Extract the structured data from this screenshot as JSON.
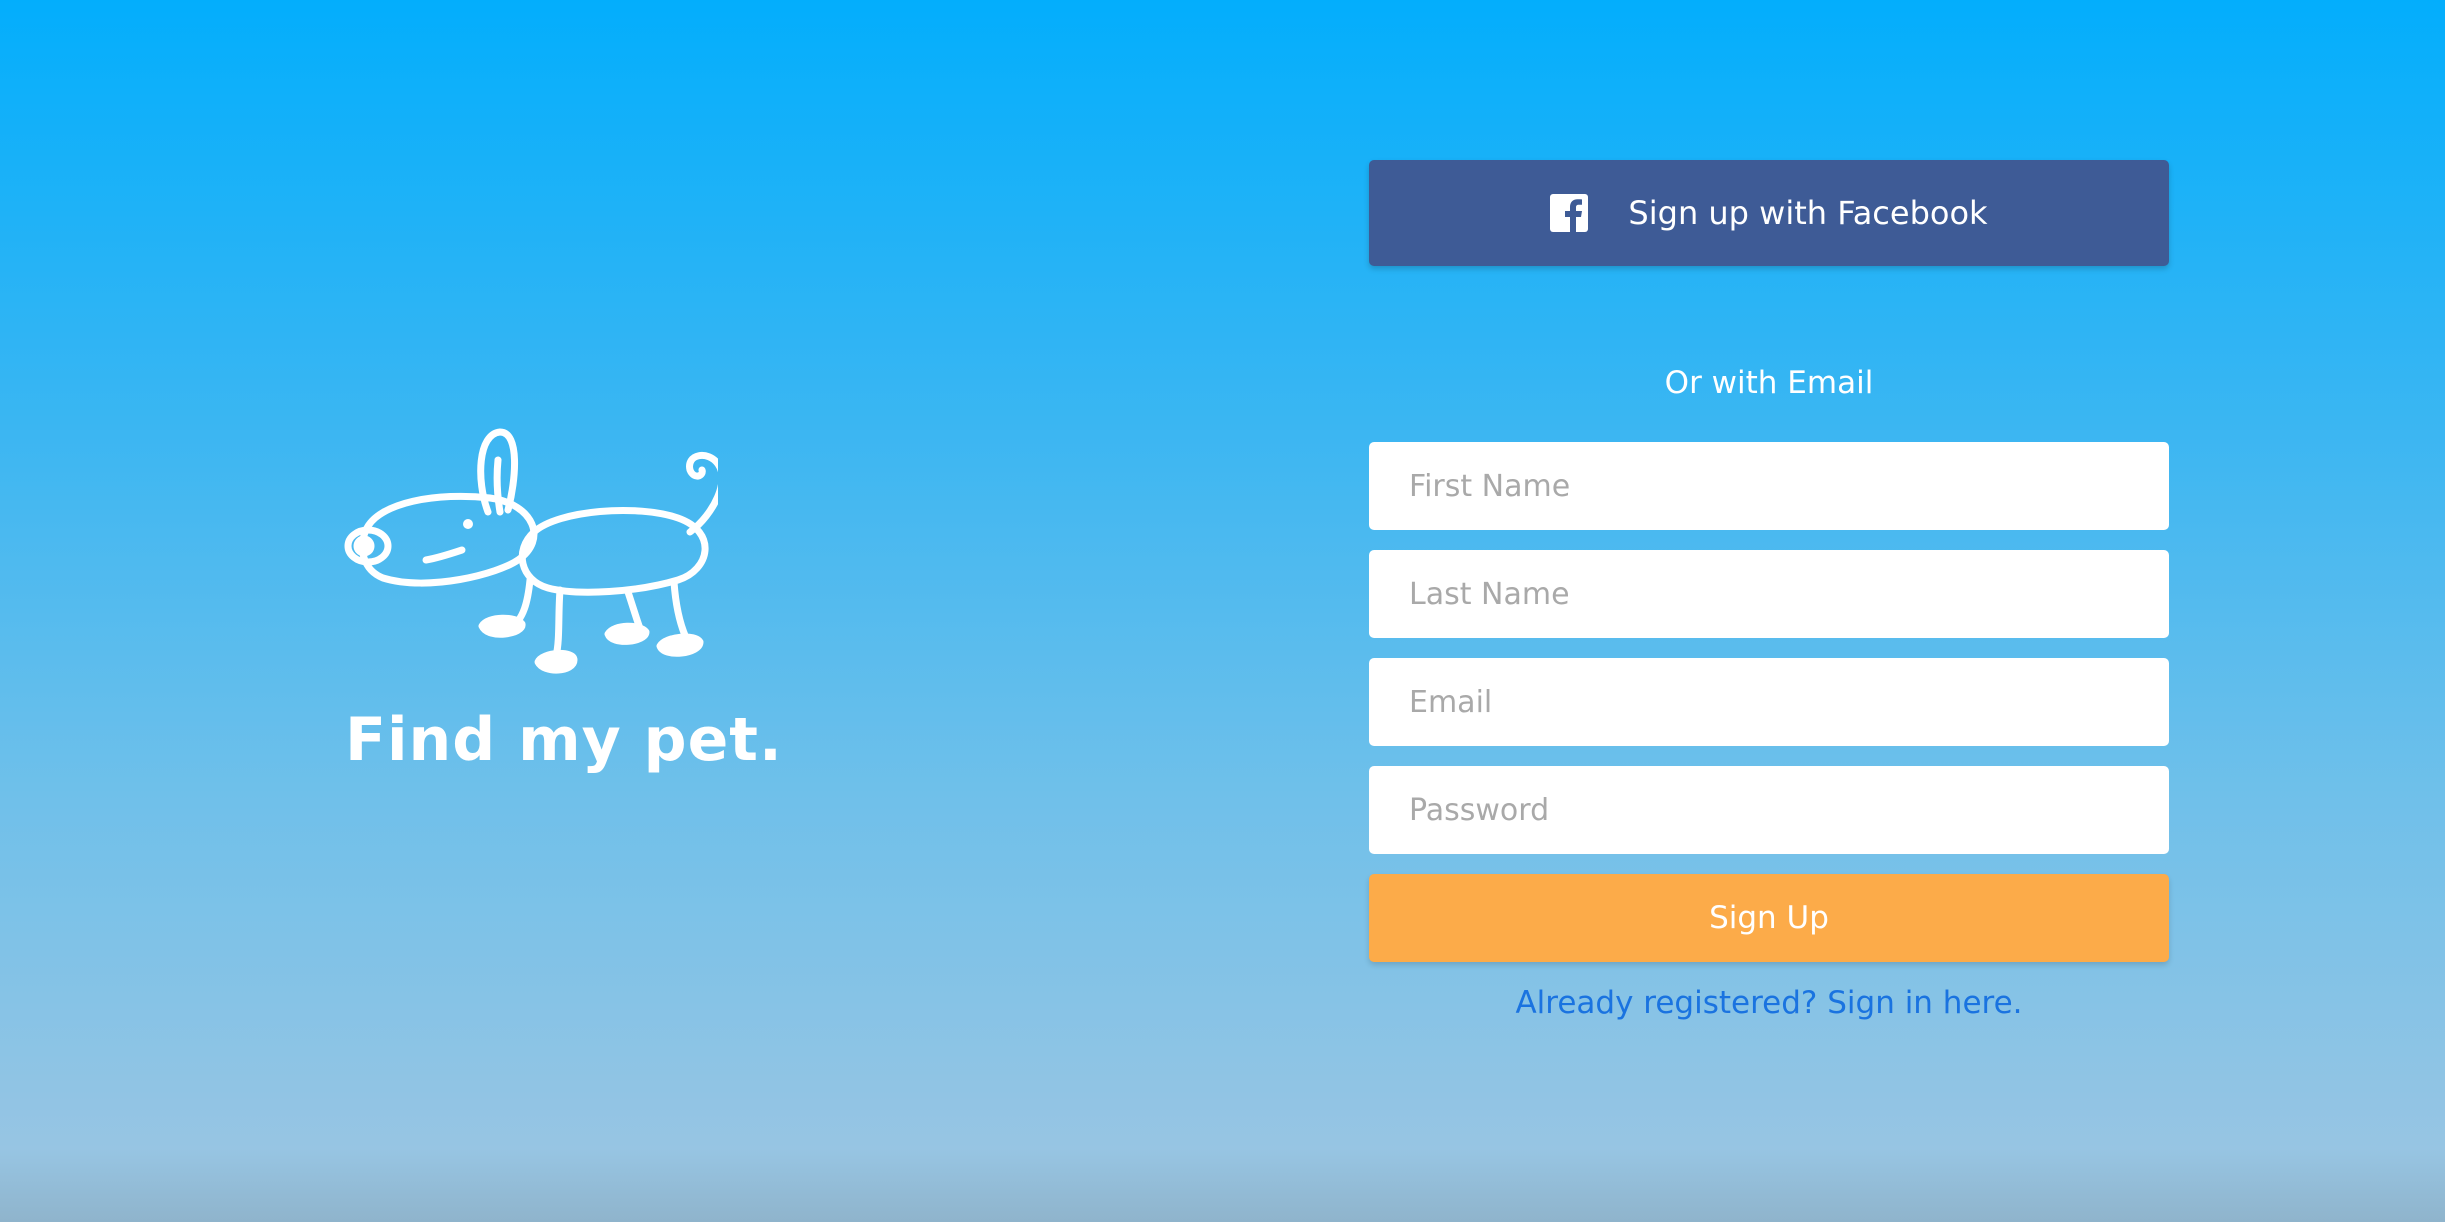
{
  "brand": {
    "title": "Find my pet.",
    "logo_icon": "dog-icon"
  },
  "facebook_button": {
    "label": "Sign up with Facebook",
    "icon": "facebook-icon",
    "color": "#3e5b96"
  },
  "divider_text": "Or with Email",
  "fields": {
    "first_name": {
      "placeholder": "First Name",
      "value": ""
    },
    "last_name": {
      "placeholder": "Last Name",
      "value": ""
    },
    "email": {
      "placeholder": "Email",
      "value": ""
    },
    "password": {
      "placeholder": "Password",
      "value": ""
    }
  },
  "signup_button": {
    "label": "Sign Up",
    "color": "#fcab49"
  },
  "signin_link": {
    "label": "Already registered? Sign in here.",
    "color": "#1a73e0"
  },
  "colors": {
    "background_top": "#03aefc",
    "background_bottom": "#97c5e3"
  }
}
